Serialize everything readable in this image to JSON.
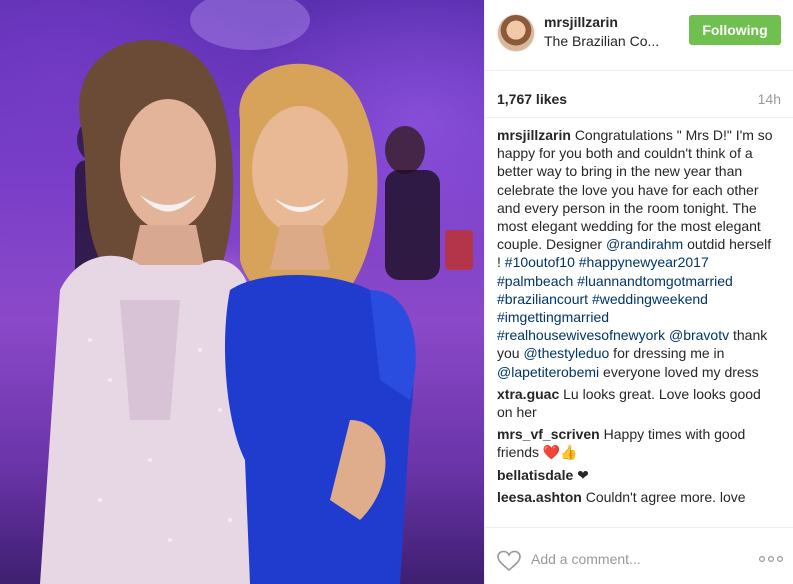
{
  "post": {
    "photo_alt": "Two women posing together at a wedding reception"
  },
  "header": {
    "username": "mrsjillzarin",
    "location": "The Brazilian Co...",
    "follow_label": "Following"
  },
  "meta": {
    "likes": "1,767 likes",
    "time": "14h"
  },
  "caption": {
    "author": "mrsjillzarin",
    "parts": [
      "Congratulations \" Mrs D!\" I'm so happy for you both and couldn't think of a better way to bring in the new year than celebrate the love you have for each other and every person in the room tonight. The most elegant wedding for the most elegant couple. Designer ",
      "@randirahm",
      " outdid herself ! ",
      "#10outof10",
      " ",
      "#happynewyear2017",
      " ",
      "#palmbeach",
      " ",
      "#luannandtomgotmarried",
      " ",
      "#braziliancourt",
      " ",
      "#weddingweekend",
      " ",
      "#imgettingmarried",
      " ",
      "#realhousewivesofnewyork",
      " ",
      "@bravotv",
      " thank you ",
      "@thestyleduo",
      " for dressing me in ",
      "@lapetiterobemi",
      " everyone loved my dress"
    ]
  },
  "comments": [
    {
      "author": "xtra.guac",
      "text": "Lu looks great. Love looks good on her"
    },
    {
      "author": "mrs_vf_scriven",
      "text": "Happy times with good friends",
      "emoji": "❤️👍"
    },
    {
      "author": "bellatisdale",
      "text": "❤"
    },
    {
      "author": "leesa.ashton",
      "text": "Couldn't agree more. love"
    }
  ],
  "footer": {
    "comment_placeholder": "Add a comment...",
    "heart_icon": "heart-outline-icon",
    "more_icon": "more-options-icon"
  },
  "colors": {
    "follow_button": "#70c050",
    "link": "#003569",
    "muted": "#999999"
  }
}
